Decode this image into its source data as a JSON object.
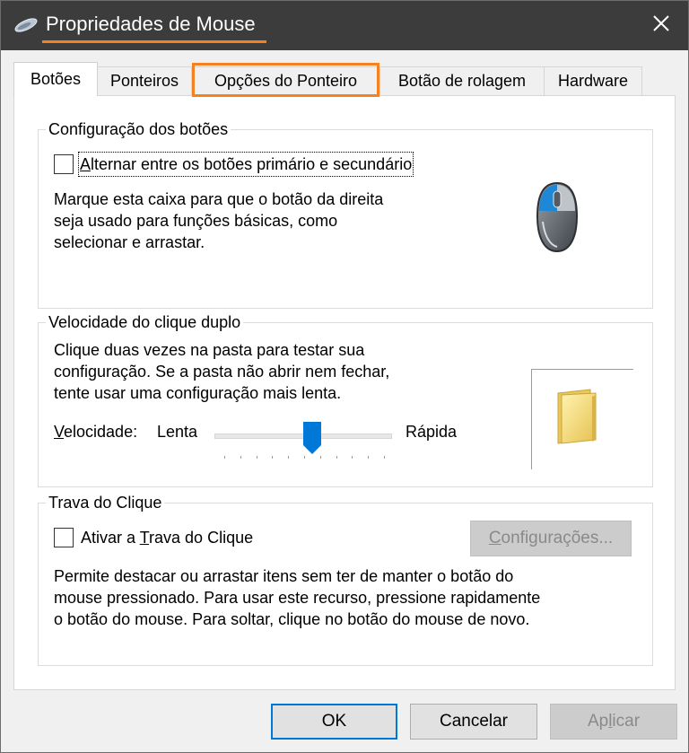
{
  "window": {
    "title": "Propriedades de Mouse",
    "accent": "#f58220"
  },
  "tabs": [
    {
      "label": "Botões",
      "active": true
    },
    {
      "label": "Ponteiros"
    },
    {
      "label": "Opções do Ponteiro",
      "highlighted": true
    },
    {
      "label": "Botão de rolagem"
    },
    {
      "label": "Hardware"
    }
  ],
  "button_config": {
    "group_title": "Configuração dos botões",
    "checkbox_label_first": "A",
    "checkbox_label_rest": "lternar entre os botões primário e secundário",
    "checked": false,
    "description_lines": [
      "Marque esta caixa para que o botão da direita",
      "seja usado para funções básicas, como",
      "selecionar e arrastar."
    ],
    "icon": "mouse-icon"
  },
  "double_click": {
    "group_title": "Velocidade do clique duplo",
    "description_lines": [
      "Clique duas vezes na pasta para testar sua",
      "configuração. Se a pasta não abrir nem fechar,",
      "tente usar uma configuração mais lenta."
    ],
    "speed_label_first": "V",
    "speed_label_rest": "elocidade:",
    "slow_label": "Lenta",
    "fast_label": "Rápida",
    "slider_value": 0.55,
    "icon": "folder-icon"
  },
  "click_lock": {
    "group_title": "Trava do Clique",
    "checkbox_label_pre": "Ativar a ",
    "checkbox_label_u": "T",
    "checkbox_label_post": "rava do Clique",
    "checked": false,
    "settings_button_first": "C",
    "settings_button_rest": "onfigurações...",
    "description_lines": [
      "Permite destacar ou arrastar itens sem ter de manter o botão do",
      "mouse pressionado. Para usar este recurso, pressione rapidamente",
      "o botão do mouse. Para soltar, clique no botão do mouse de novo."
    ]
  },
  "footer": {
    "ok": "OK",
    "cancel": "Cancelar",
    "apply_pre": "Ap",
    "apply_u": "l",
    "apply_post": "icar"
  }
}
